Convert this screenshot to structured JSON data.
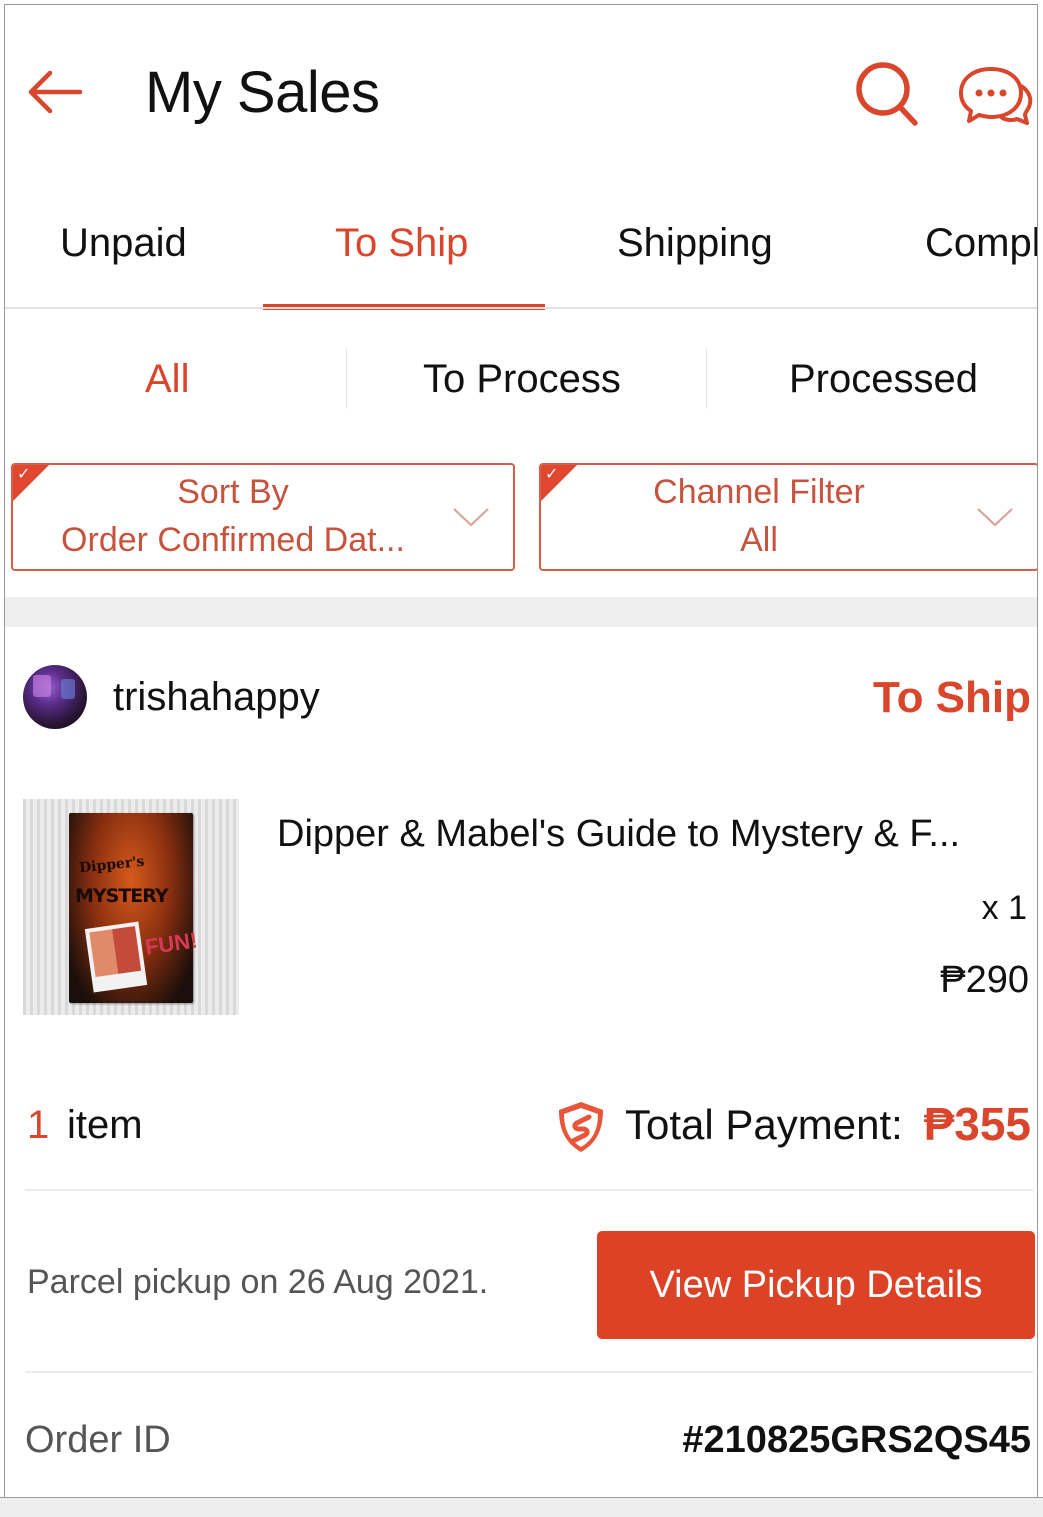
{
  "header": {
    "title": "My Sales",
    "back_icon": "arrow-left-icon",
    "search_icon": "search-icon",
    "chat_icon": "chat-bubbles-icon"
  },
  "tabs": [
    {
      "label": "Unpaid",
      "active": false
    },
    {
      "label": "To Ship",
      "active": true
    },
    {
      "label": "Shipping",
      "active": false
    },
    {
      "label": "Compl",
      "active": false
    }
  ],
  "subtabs": [
    {
      "label": "All",
      "active": true
    },
    {
      "label": "To Process",
      "active": false
    },
    {
      "label": "Processed",
      "active": false
    }
  ],
  "filters": {
    "sort": {
      "label": "Sort By",
      "value": "Order Confirmed Dat..."
    },
    "channel": {
      "label": "Channel Filter",
      "value": "All"
    }
  },
  "order": {
    "shop_name": "trishahappy",
    "status": "To Ship",
    "product": {
      "name": "Dipper & Mabel's Guide to Mystery & F...",
      "quantity": "x 1",
      "price": "₱290",
      "thumb_text_1": "Dipper's",
      "thumb_text_2": "MYSTERY",
      "thumb_text_3": "FUN!"
    },
    "item_count": "1",
    "item_label": "item",
    "total_label": "Total Payment:",
    "total_value": "₱355",
    "pickup_text": "Parcel pickup on 26 Aug 2021.",
    "pickup_button": "View Pickup Details",
    "order_id_label": "Order ID",
    "order_id_value": "#210825GRS2QS45"
  },
  "colors": {
    "accent": "#d9462b",
    "button": "#dc4226",
    "filter_border": "#d2604a"
  }
}
